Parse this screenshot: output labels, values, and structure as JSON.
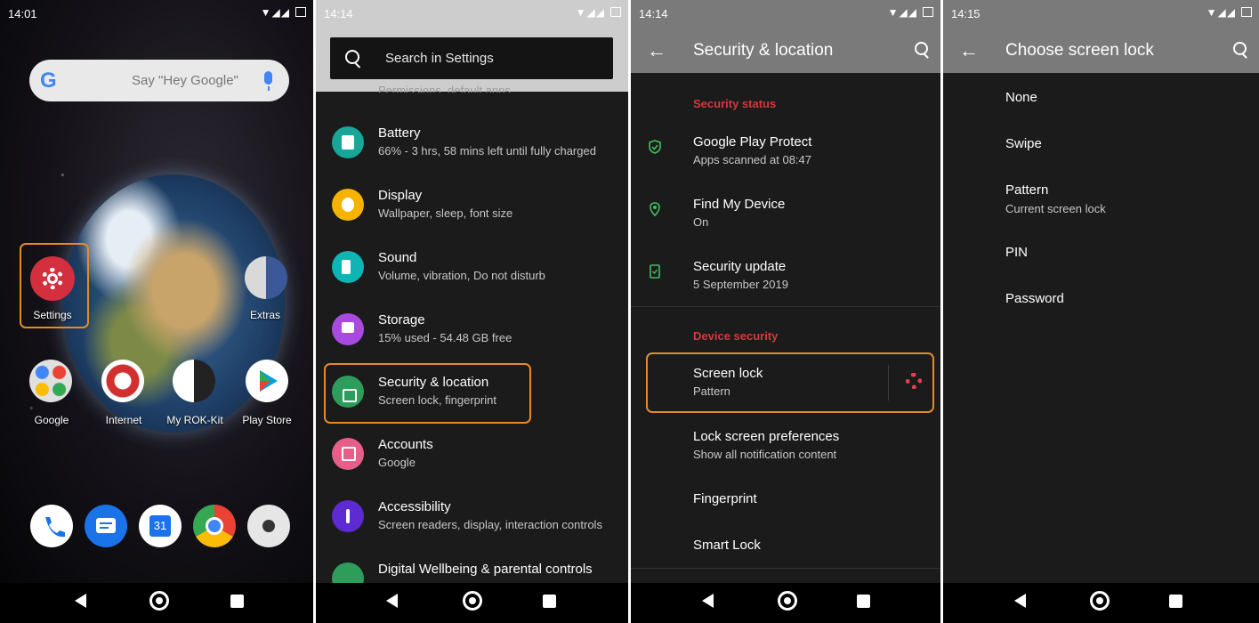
{
  "panel1": {
    "time": "14:01",
    "search_hint": "Say \"Hey Google\"",
    "apps": {
      "settings": "Settings",
      "extras": "Extras",
      "google": "Google",
      "internet": "Internet",
      "my_rok_kit": "My ROK-Kit",
      "play_store": "Play Store"
    },
    "dock": {
      "calendar_day": "31"
    }
  },
  "panel2": {
    "time": "14:14",
    "search_placeholder": "Search in Settings",
    "partial_top": "Permissions, default apps",
    "items": [
      {
        "title": "Battery",
        "subtitle": "66% - 3 hrs, 58 mins left until fully charged",
        "color": "#17a697",
        "icon": "battery-icon"
      },
      {
        "title": "Display",
        "subtitle": "Wallpaper, sleep, font size",
        "color": "#f6b300",
        "icon": "display-icon"
      },
      {
        "title": "Sound",
        "subtitle": "Volume, vibration, Do not disturb",
        "color": "#0fb4b4",
        "icon": "sound-icon"
      },
      {
        "title": "Storage",
        "subtitle": "15% used - 54.48 GB free",
        "color": "#a84ae0",
        "icon": "storage-icon"
      },
      {
        "title": "Security & location",
        "subtitle": "Screen lock, fingerprint",
        "color": "#2e9c5a",
        "icon": "lock-icon"
      },
      {
        "title": "Accounts",
        "subtitle": "Google",
        "color": "#e85e8a",
        "icon": "accounts-icon"
      },
      {
        "title": "Accessibility",
        "subtitle": "Screen readers, display, interaction controls",
        "color": "#5e2ad1",
        "icon": "accessibility-icon"
      },
      {
        "title": "Digital Wellbeing & parental controls",
        "subtitle": "",
        "color": "#2e9c5a",
        "icon": "wellbeing-icon"
      }
    ]
  },
  "panel3": {
    "time": "14:14",
    "title": "Security & location",
    "section_status": "Security status",
    "section_device": "Device security",
    "status_items": [
      {
        "title": "Google Play Protect",
        "subtitle": "Apps scanned at 08:47",
        "icon": "shield-icon"
      },
      {
        "title": "Find My Device",
        "subtitle": "On",
        "icon": "location-icon"
      },
      {
        "title": "Security update",
        "subtitle": "5 September 2019",
        "icon": "phone-update-icon"
      }
    ],
    "screen_lock": {
      "title": "Screen lock",
      "subtitle": "Pattern"
    },
    "device_items": [
      {
        "title": "Lock screen preferences",
        "subtitle": "Show all notification content"
      },
      {
        "title": "Fingerprint",
        "subtitle": ""
      },
      {
        "title": "Smart Lock",
        "subtitle": ""
      }
    ],
    "accent": "#d53a3a"
  },
  "panel4": {
    "time": "14:15",
    "title": "Choose screen lock",
    "options": [
      {
        "label": "None",
        "sub": ""
      },
      {
        "label": "Swipe",
        "sub": ""
      },
      {
        "label": "Pattern",
        "sub": "Current screen lock"
      },
      {
        "label": "PIN",
        "sub": ""
      },
      {
        "label": "Password",
        "sub": ""
      }
    ]
  },
  "highlight_color": "#e58a2a"
}
